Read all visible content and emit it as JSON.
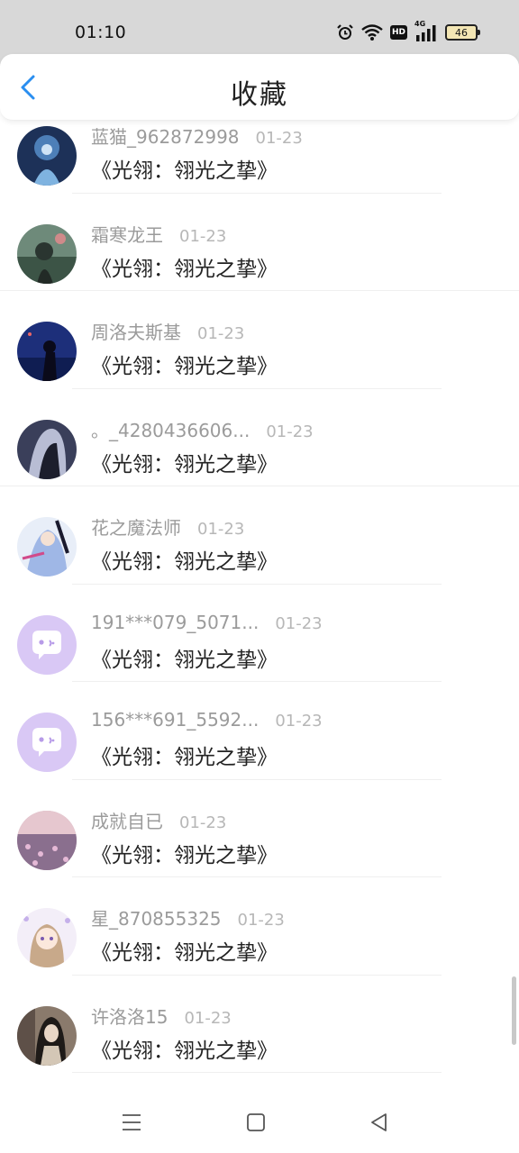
{
  "status_bar": {
    "time": "01:10",
    "network": "4G",
    "hd": "HD",
    "battery": "46"
  },
  "header": {
    "title": "收藏"
  },
  "items": [
    {
      "username": "蓝猫_962872998",
      "date": "01-23",
      "title": "《光翎：翎光之挚》"
    },
    {
      "username": "霜寒龙王",
      "date": "01-23",
      "title": "《光翎：翎光之挚》"
    },
    {
      "username": "周洛夫斯基",
      "date": "01-23",
      "title": "《光翎：翎光之挚》"
    },
    {
      "username": "。_4280436606...",
      "date": "01-23",
      "title": "《光翎：翎光之挚》"
    },
    {
      "username": "花之魔法师",
      "date": "01-23",
      "title": "《光翎：翎光之挚》"
    },
    {
      "username": "191***079_5071...",
      "date": "01-23",
      "title": "《光翎：翎光之挚》"
    },
    {
      "username": "156***691_5592...",
      "date": "01-23",
      "title": "《光翎：翎光之挚》"
    },
    {
      "username": "成就自已",
      "date": "01-23",
      "title": "《光翎：翎光之挚》"
    },
    {
      "username": "星_870855325",
      "date": "01-23",
      "title": "《光翎：翎光之挚》"
    },
    {
      "username": "许洛洛15",
      "date": "01-23",
      "title": "《光翎：翎光之挚》"
    }
  ],
  "colors": {
    "accent": "#2a8ef0",
    "default_avatar": "#d9c8f5"
  }
}
